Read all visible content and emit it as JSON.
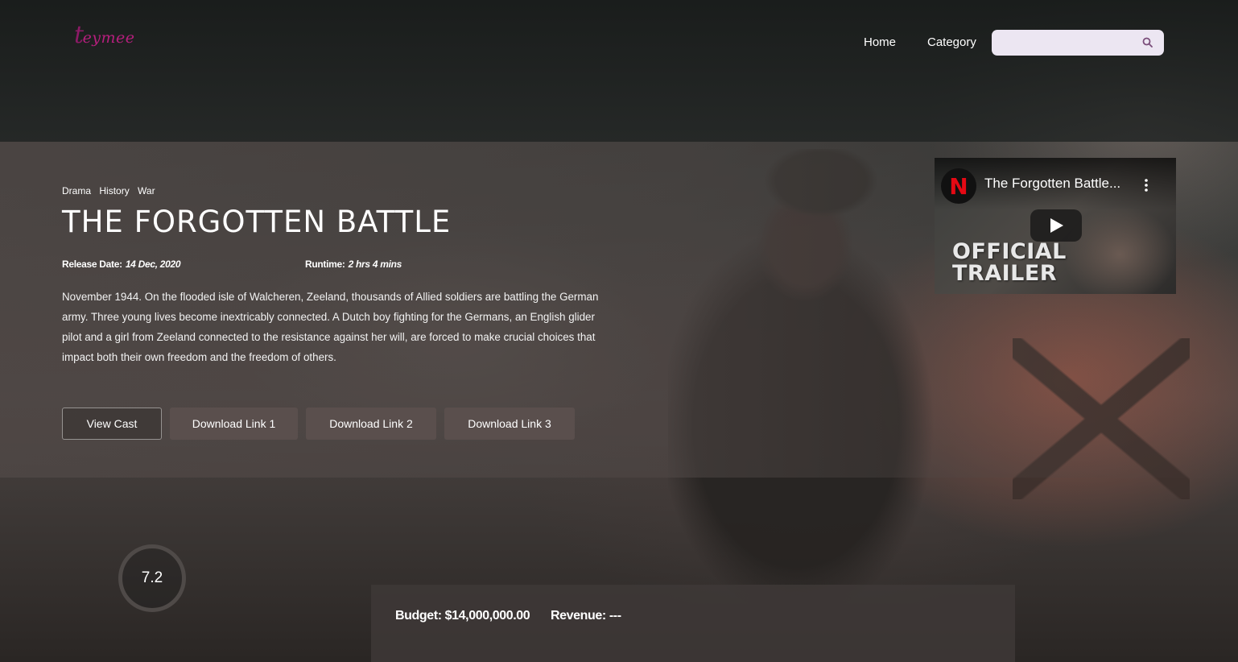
{
  "brand": {
    "logo_initial": "t",
    "logo_rest": "eymee"
  },
  "nav": {
    "home_label": "Home",
    "category_label": "Category"
  },
  "search": {
    "placeholder": ""
  },
  "movie": {
    "genres": [
      "Drama",
      "History",
      "War"
    ],
    "title": "THE FORGOTTEN BATTLE",
    "release_label": "Release Date:",
    "release_value": "14 Dec, 2020",
    "runtime_label": "Runtime:",
    "runtime_value": "2 hrs 4 mins",
    "overview": "November 1944. On the flooded isle of Walcheren, Zeeland, thousands of Allied soldiers are battling the German army. Three young lives become inextricably connected. A Dutch boy fighting for the Germans, an English glider pilot and a girl from Zeeland connected to the resistance against her will, are forced to make crucial choices that impact both their own freedom and the freedom of others.",
    "rating": "7.2",
    "budget": "Budget: $14,000,000.00",
    "revenue": "Revenue: ---"
  },
  "actions": {
    "view_cast": "View Cast",
    "download_1": "Download Link 1",
    "download_2": "Download Link 2",
    "download_3": "Download Link 3"
  },
  "video": {
    "channel_initial": "N",
    "title": "The Forgotten Battle...",
    "overlay_line1": "OFFICIAL",
    "overlay_line2": "TRAILER"
  },
  "icons": {
    "search": "search-icon",
    "play": "play-icon",
    "menu": "kebab-menu-icon"
  },
  "colors": {
    "brand": "#b51f7d",
    "button_bg": "#5a4f4d",
    "search_bg": "#ece6f2",
    "rating_ring": "#4f4a48",
    "netflix_red": "#e50914"
  }
}
